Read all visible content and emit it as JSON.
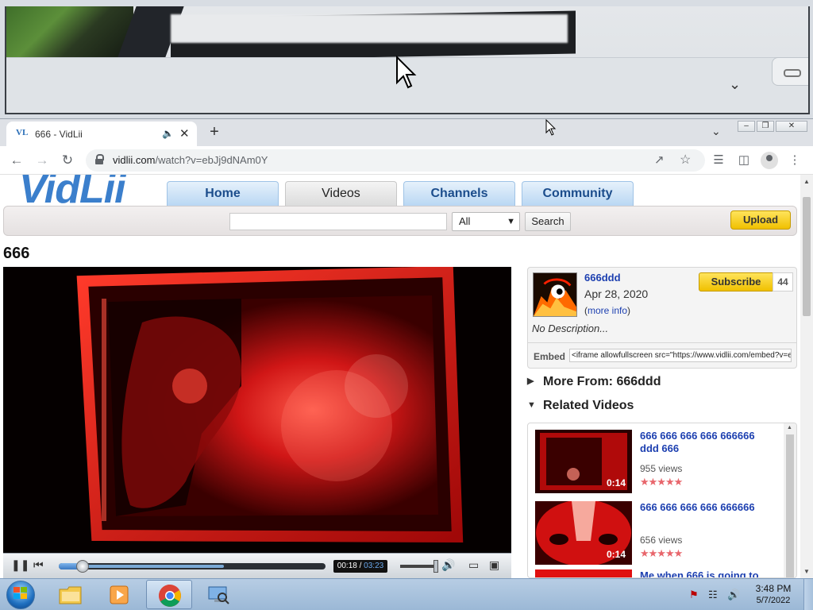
{
  "browser": {
    "tab_title": "666 - VidLii",
    "favicon_text": "VL",
    "url_domain": "vidlii.com",
    "url_path": "/watch?v=ebJj9dNAm0Y"
  },
  "site": {
    "logo": "VidLii",
    "nav": [
      "Home",
      "Videos",
      "Channels",
      "Community"
    ],
    "active_nav": "Videos",
    "search": {
      "placeholder": "",
      "category": "All",
      "button": "Search"
    },
    "upload_label": "Upload"
  },
  "video": {
    "title": "666",
    "current_time": "00:18",
    "duration": "03:23",
    "progress_fraction": 0.089,
    "buffered_fraction": 0.62
  },
  "uploader": {
    "name": "666ddd",
    "date": "Apr 28, 2020",
    "more_info_prefix": "(",
    "more_info_link": "more info",
    "more_info_suffix": ")",
    "subscribe_label": "Subscribe",
    "subscriber_count": "44",
    "description": "No Description...",
    "embed_label": "Embed",
    "embed_code": "<iframe allowfullscreen src=\"https://www.vidlii.com/embed?v=e"
  },
  "sections": {
    "more_from": "More From: 666ddd",
    "related": "Related Videos"
  },
  "related_videos": [
    {
      "title": "666 666 666 666 666666 ddd 666",
      "views": "955 views",
      "duration": "0:14",
      "rating": 5
    },
    {
      "title": "666 666 666 666 666666",
      "views": "656 views",
      "duration": "0:14",
      "rating": 5
    },
    {
      "title": "Me when 666 is going to",
      "views": "",
      "duration": "",
      "rating": 0
    }
  ],
  "taskbar": {
    "time": "3:48 PM",
    "date": "5/7/2022"
  },
  "colors": {
    "link_blue": "#1c3fb0",
    "accent_yellow": "#f0c000",
    "nav_blue": "#1c4d8c",
    "video_red": "#c81010"
  }
}
